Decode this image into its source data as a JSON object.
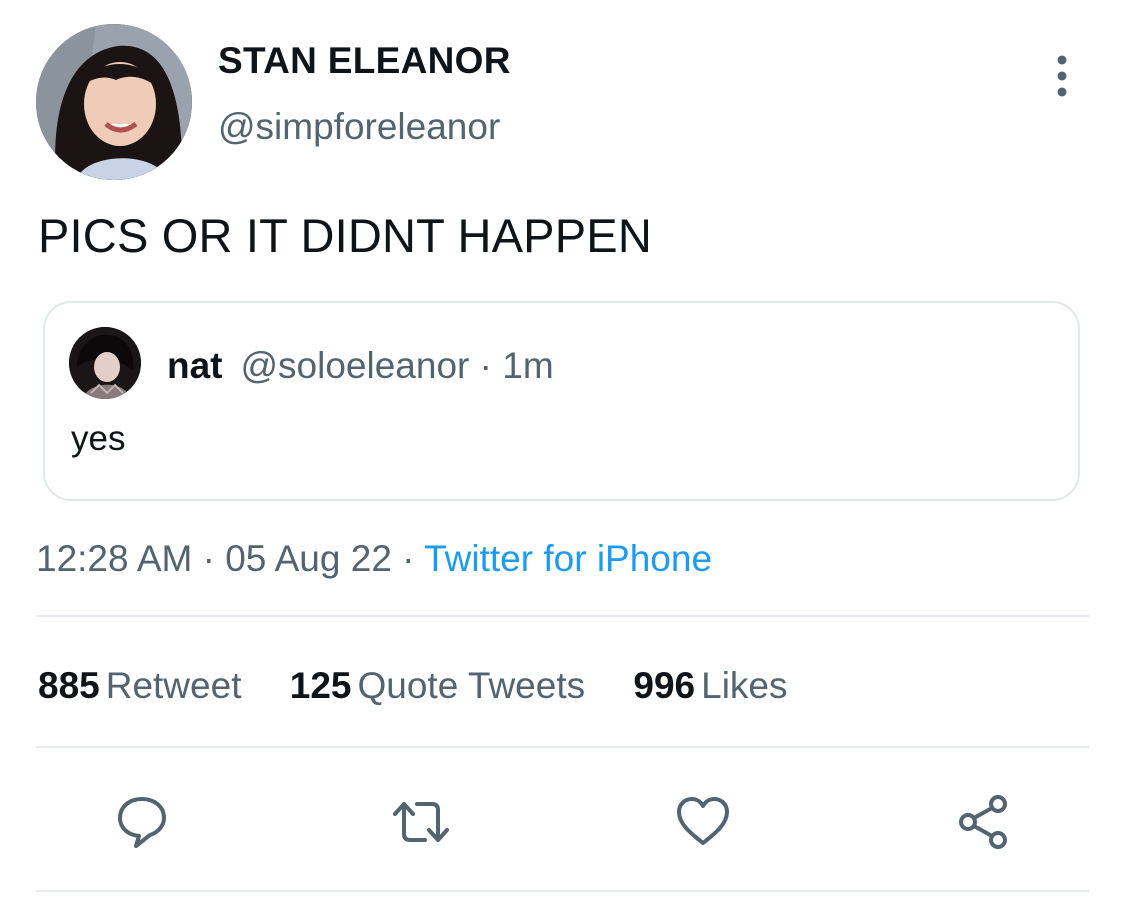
{
  "tweet": {
    "display_name": "STAN ELEANOR",
    "handle": "@simpforeleanor",
    "text": "PICS OR IT DIDNT HAPPEN",
    "more_icon": "more-vertical-icon"
  },
  "quoted_tweet": {
    "name": "nat",
    "meta": "@soloeleanor · 1m",
    "text": "yes"
  },
  "timestamp": {
    "time": "12:28 AM",
    "separator1": " · ",
    "date": "05 Aug 22",
    "separator2": " · ",
    "source": "Twitter for iPhone"
  },
  "stats": {
    "retweets": {
      "count": "885",
      "label": "Retweet"
    },
    "quotes": {
      "count": "125",
      "label": "Quote Tweets"
    },
    "likes": {
      "count": "996",
      "label": "Likes"
    }
  },
  "actions": {
    "reply_icon": "reply-icon",
    "retweet_icon": "retweet-icon",
    "like_icon": "heart-icon",
    "share_icon": "share-icon"
  },
  "colors": {
    "primary_text": "#0f1419",
    "secondary_text": "#536471",
    "link": "#1d9bf0",
    "border": "#e1e8ed",
    "icon": "#536471"
  }
}
